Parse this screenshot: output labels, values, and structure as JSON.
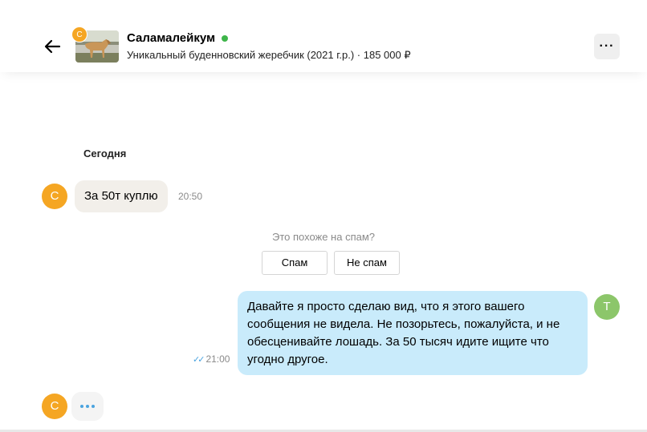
{
  "header": {
    "title": "Саламалейкум",
    "subtitle": "Уникальный буденновский жеребчик (2021 г.р.) · 185 000 ₽",
    "seller_initial": "С",
    "more_label": "···"
  },
  "chat": {
    "date_label": "Сегодня",
    "incoming": {
      "avatar_initial": "С",
      "text": "За 50т куплю",
      "time": "20:50"
    },
    "spam": {
      "question": "Это похоже на спам?",
      "spam_label": "Спам",
      "not_spam_label": "Не спам"
    },
    "outgoing": {
      "avatar_initial": "Т",
      "text": "Давайте я просто сделаю вид, что я этого вашего сообщения не видела. Не позорьтесь, пожалуйста, и не обесценивайте лошадь. За 50 тысяч идите ищите что угодно другое.",
      "time": "21:00",
      "status_icon": "double-check-icon"
    },
    "typing": {
      "avatar_initial": "С"
    }
  },
  "colors": {
    "seller_avatar": "#f5a623",
    "user_avatar": "#8cc66a",
    "online": "#3eb54a",
    "outgoing_bubble": "#c9ebfb",
    "incoming_bubble": "#f2efea"
  }
}
